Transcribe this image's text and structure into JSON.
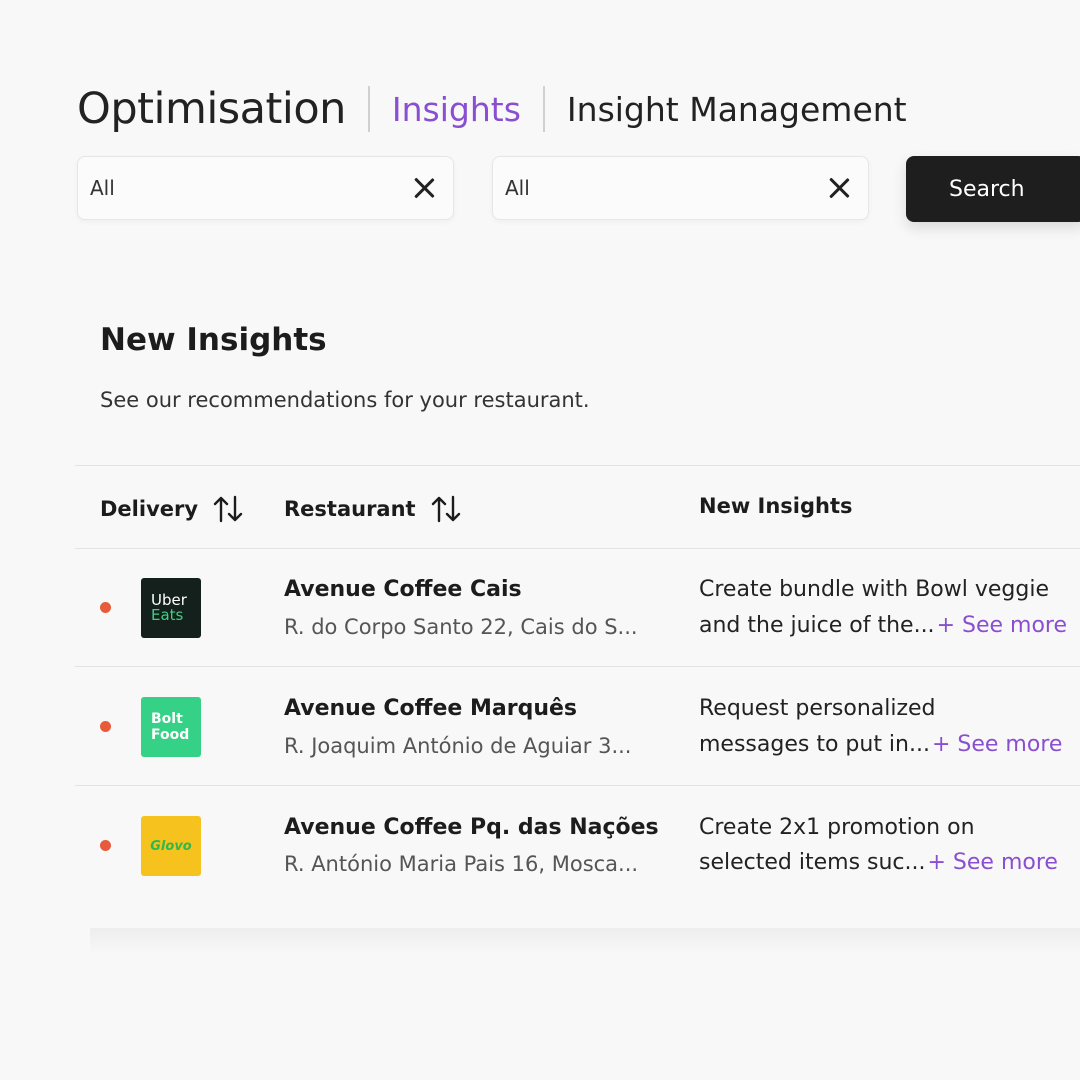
{
  "header": {
    "title": "Optimisation",
    "tabs": [
      {
        "label": "Insights",
        "active": true
      },
      {
        "label": "Insight Management",
        "active": false
      }
    ]
  },
  "filters": [
    {
      "value": "All",
      "clear_icon": "close-icon"
    },
    {
      "value": "All",
      "clear_icon": "close-icon"
    }
  ],
  "search_button": "Search",
  "section": {
    "title": "New Insights",
    "subtitle": "See our recommendations for your restaurant."
  },
  "table": {
    "headers": {
      "delivery": "Delivery",
      "restaurant": "Restaurant",
      "insights": "New Insights"
    },
    "rows": [
      {
        "logo": {
          "line1": "Uber",
          "line2": "Eats"
        },
        "name": "Avenue Coffee Cais",
        "address": "R. do Corpo Santo 22, Cais do S...",
        "insight_line1": "Create bundle with Bowl veggie",
        "insight_line2": "and the juice of the...",
        "see_more": "+ See more"
      },
      {
        "logo": {
          "line1": "Bolt",
          "line2": "Food"
        },
        "name": "Avenue Coffee Marquês",
        "address": "R. Joaquim António de Aguiar 3...",
        "insight_line1": "Request personalized",
        "insight_line2": "messages to put in...",
        "see_more": "+ See more"
      },
      {
        "logo": {
          "line1": "Glovo",
          "line2": ""
        },
        "name": "Avenue Coffee Pq. das Nações",
        "address": "R. António Maria Pais 16, Mosca...",
        "insight_line1": "Create 2x1 promotion on",
        "insight_line2": "selected items suc...",
        "see_more": "+ See more"
      }
    ]
  },
  "colors": {
    "accent": "#8a4fd0",
    "status_dot": "#e85a3c",
    "search_bg": "#1e1e1e"
  }
}
